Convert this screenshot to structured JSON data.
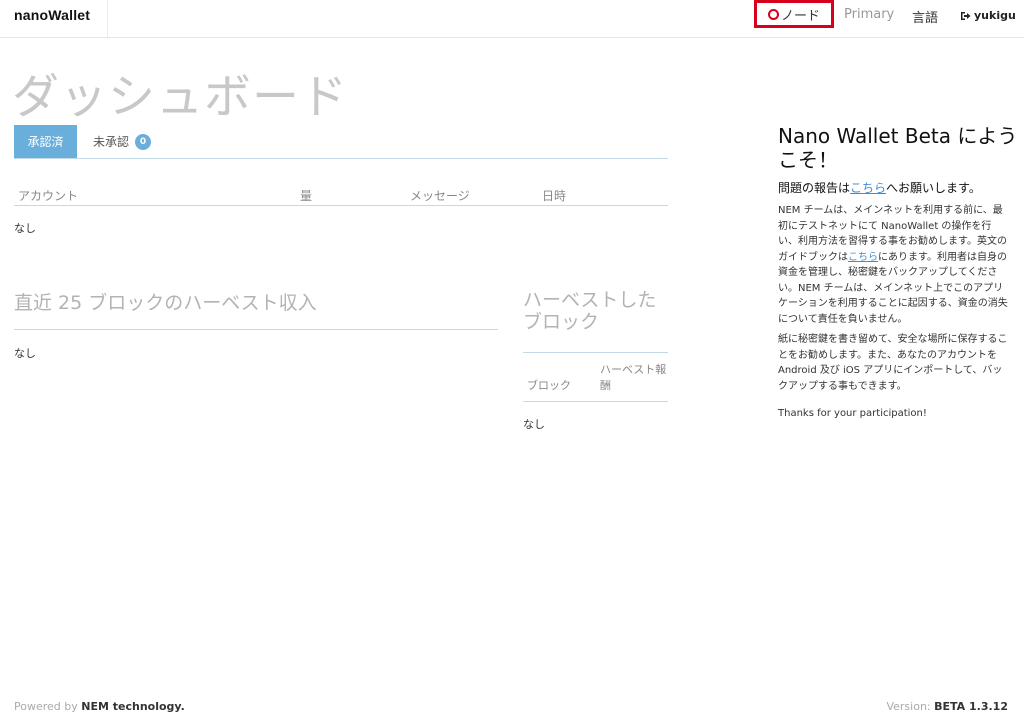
{
  "header": {
    "brand": "nanoWallet",
    "node_label": "ノード",
    "account_type": "Primary",
    "language_label": "言語",
    "username": "yukigu"
  },
  "dashboard": {
    "title": "ダッシュボード",
    "tabs": {
      "confirmed": "承認済",
      "unconfirmed": "未承認",
      "unconfirmed_count": "0"
    },
    "tx_table": {
      "columns": [
        "アカウント",
        "量",
        "メッセージ",
        "日時"
      ],
      "empty": "なし"
    },
    "harvest_income": {
      "title": "直近 25 ブロックのハーベスト収入",
      "empty": "なし"
    },
    "harvested_blocks": {
      "title": "ハーベストしたブロック",
      "col_block": "ブロック",
      "col_reward": "ハーベスト報酬",
      "empty": "なし"
    }
  },
  "welcome": {
    "title": "Nano Wallet Beta にようこそ！",
    "report_prefix": "問題の報告は",
    "report_link": "こちら",
    "report_suffix": "へお願いします。",
    "para1_a": "NEM チームは、メインネットを利用する前に、最初にテストネットにて NanoWallet の操作を行い、利用方法を習得する事をお勧めします。英文のガイドブックは",
    "para1_link": "こちら",
    "para1_b": "にあります。利用者は自身の資金を管理し、秘密鍵をバックアップしてください。NEM チームは、メインネット上でこのアプリケーションを利用することに起因する、資金の消失について責任を負いません。",
    "para2": "紙に秘密鍵を書き留めて、安全な場所に保存することをお勧めします。また、あなたのアカウントをAndroid 及び iOS アプリにインポートして、バックアップする事もできます。",
    "para3": "Thanks for your participation!"
  },
  "footer": {
    "powered_prefix": "Powered by",
    "powered_by": "NEM technology.",
    "version_prefix": "Version:",
    "version": "BETA 1.3.12"
  },
  "colors": {
    "accent": "#6aaedb",
    "highlight_box": "#d6001c",
    "link": "#3c8dd6"
  }
}
